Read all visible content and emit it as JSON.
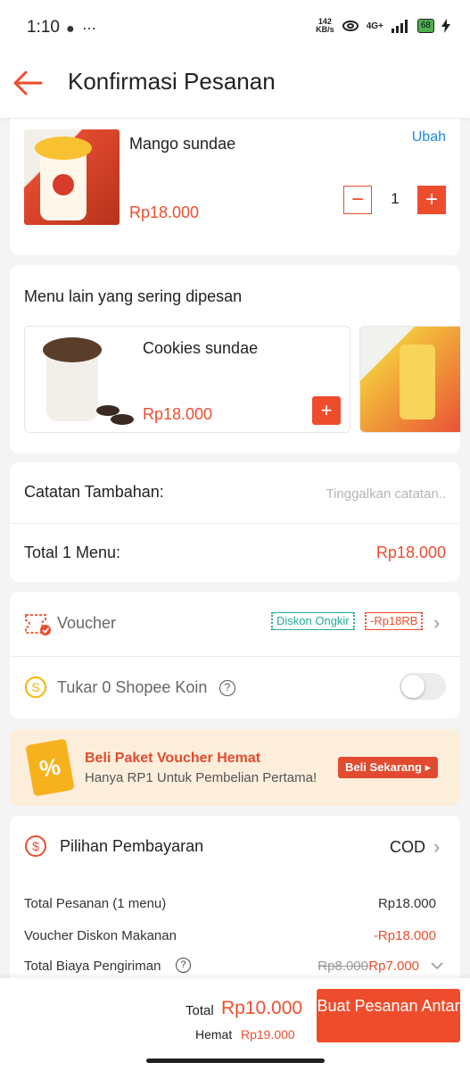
{
  "status_bar": {
    "time": "1:10",
    "left_icons": "● ⋯",
    "speed_top": "142",
    "speed_bottom": "KB/s",
    "network": "4G+",
    "battery": "68"
  },
  "header": {
    "title": "Konfirmasi Pesanan"
  },
  "cart_item": {
    "name": "Mango sundae",
    "price": "Rp18.000",
    "edit_label": "Ubah",
    "quantity": "1",
    "minus": "−",
    "plus": "+"
  },
  "recommendations": {
    "title": "Menu lain yang sering dipesan",
    "items": [
      {
        "name": "Cookies sundae",
        "price": "Rp18.000",
        "add": "+"
      }
    ]
  },
  "notes": {
    "label": "Catatan Tambahan:",
    "placeholder": "Tinggalkan catatan.."
  },
  "subtotal": {
    "label": "Total 1 Menu:",
    "value": "Rp18.000"
  },
  "voucher": {
    "label": "Voucher",
    "tag_shipping": "Diskon Ongkir",
    "tag_discount": "-Rp18RB"
  },
  "coins": {
    "label": "Tukar 0 Shopee Koin",
    "help": "?",
    "toggle_on": false
  },
  "promo_banner": {
    "icon": "%",
    "title": "Beli Paket Voucher Hemat",
    "subtitle": "Hanya RP1 Untuk Pembelian Pertama!",
    "button": "Beli Sekarang ▸"
  },
  "payment": {
    "label": "Pilihan Pembayaran",
    "method": "COD"
  },
  "summary": {
    "order_label": "Total Pesanan (1 menu)",
    "order_value": "Rp18.000",
    "food_voucher_label": "Voucher Diskon Makanan",
    "food_voucher_value": "-Rp18.000",
    "shipping_label": "Total Biaya Pengiriman",
    "shipping_original": "Rp8.000",
    "shipping_value": "Rp7.000"
  },
  "footer": {
    "total_label": "Total",
    "total_value": "Rp10.000",
    "savings_label": "Hemat",
    "savings_value": "Rp19.000",
    "button_label": "Buat Pesanan Antar"
  },
  "colors": {
    "accent": "#ee4d2d",
    "link": "#1e88e5",
    "tag_green": "#26aa99",
    "banner_bg": "#fdeedb"
  }
}
